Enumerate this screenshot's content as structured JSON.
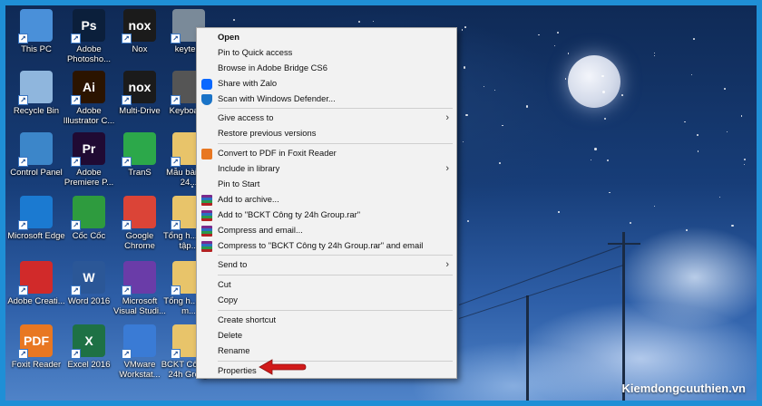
{
  "desktop": {
    "icons": [
      {
        "label": "This PC",
        "abbr": "",
        "bg": "#4a90d9"
      },
      {
        "label": "Adobe Photosho...",
        "abbr": "Ps",
        "bg": "#0b1f3b"
      },
      {
        "label": "Nox",
        "abbr": "nox",
        "bg": "#1b1b1b"
      },
      {
        "label": "keyte...",
        "abbr": "",
        "bg": "#7a8a99"
      },
      {
        "label": "Recycle Bin",
        "abbr": "",
        "bg": "#8fb6dd"
      },
      {
        "label": "Adobe Illustrator C...",
        "abbr": "Ai",
        "bg": "#2b1400"
      },
      {
        "label": "Multi-Drive",
        "abbr": "nox",
        "bg": "#1b1b1b"
      },
      {
        "label": "Keyboar...",
        "abbr": "",
        "bg": "#555"
      },
      {
        "label": "Control Panel",
        "abbr": "",
        "bg": "#3c86c9"
      },
      {
        "label": "Adobe Premiere P...",
        "abbr": "Pr",
        "bg": "#200a33"
      },
      {
        "label": "TranS",
        "abbr": "",
        "bg": "#2ca84a"
      },
      {
        "label": "Mẫu bài tập 24...",
        "abbr": "",
        "bg": "#e8c46a"
      },
      {
        "label": "Microsoft Edge",
        "abbr": "",
        "bg": "#1b7ad1"
      },
      {
        "label": "Cốc Cốc",
        "abbr": "",
        "bg": "#2e9b3e"
      },
      {
        "label": "Google Chrome",
        "abbr": "",
        "bg": "#db4437"
      },
      {
        "label": "Tổng h... đầu tập...",
        "abbr": "",
        "bg": "#e8c46a"
      },
      {
        "label": "Adobe Creati...",
        "abbr": "",
        "bg": "#d12a2a"
      },
      {
        "label": "Word 2016",
        "abbr": "W",
        "bg": "#2b5797"
      },
      {
        "label": "Microsoft Visual Studi...",
        "abbr": "",
        "bg": "#6a3ca8"
      },
      {
        "label": "Tổng h... cáo m...",
        "abbr": "",
        "bg": "#e8c46a"
      },
      {
        "label": "Foxit Reader",
        "abbr": "PDF",
        "bg": "#e87722"
      },
      {
        "label": "Excel 2016",
        "abbr": "X",
        "bg": "#1e7145"
      },
      {
        "label": "VMware Workstat...",
        "abbr": "",
        "bg": "#3a7bd5"
      },
      {
        "label": "BCKT Công ty 24h Group",
        "abbr": "",
        "bg": "#e8c46a"
      }
    ]
  },
  "context_menu": {
    "items": [
      {
        "type": "item",
        "label": "Open",
        "bold": true,
        "icon": ""
      },
      {
        "type": "item",
        "label": "Pin to Quick access",
        "icon": ""
      },
      {
        "type": "item",
        "label": "Browse in Adobe Bridge CS6",
        "icon": ""
      },
      {
        "type": "item",
        "label": "Share with Zalo",
        "icon": "zalo-icon"
      },
      {
        "type": "item",
        "label": "Scan with Windows Defender...",
        "icon": "defender-icon"
      },
      {
        "type": "sep"
      },
      {
        "type": "item",
        "label": "Give access to",
        "submenu": true,
        "icon": ""
      },
      {
        "type": "item",
        "label": "Restore previous versions",
        "icon": ""
      },
      {
        "type": "sep"
      },
      {
        "type": "item",
        "label": "Convert to PDF in Foxit Reader",
        "icon": "foxit-icon"
      },
      {
        "type": "item",
        "label": "Include in library",
        "submenu": true,
        "icon": ""
      },
      {
        "type": "item",
        "label": "Pin to Start",
        "icon": ""
      },
      {
        "type": "item",
        "label": "Add to archive...",
        "icon": "winrar-icon"
      },
      {
        "type": "item",
        "label": "Add to \"BCKT Công ty 24h Group.rar\"",
        "icon": "winrar-icon"
      },
      {
        "type": "item",
        "label": "Compress and email...",
        "icon": "winrar-icon"
      },
      {
        "type": "item",
        "label": "Compress to \"BCKT Công ty 24h Group.rar\" and email",
        "icon": "winrar-icon"
      },
      {
        "type": "sep"
      },
      {
        "type": "item",
        "label": "Send to",
        "submenu": true,
        "icon": ""
      },
      {
        "type": "sep"
      },
      {
        "type": "item",
        "label": "Cut",
        "icon": ""
      },
      {
        "type": "item",
        "label": "Copy",
        "icon": ""
      },
      {
        "type": "sep"
      },
      {
        "type": "item",
        "label": "Create shortcut",
        "icon": ""
      },
      {
        "type": "item",
        "label": "Delete",
        "icon": ""
      },
      {
        "type": "item",
        "label": "Rename",
        "icon": ""
      },
      {
        "type": "sep"
      },
      {
        "type": "item",
        "label": "Properties",
        "icon": ""
      }
    ],
    "submenu_glyph": "›",
    "highlight_arrow_color": "#d11a1a"
  },
  "watermark": "Kiemdongcuuthien.vn",
  "colors": {
    "frame": "#1f8fd6",
    "menu_bg": "#f2f2f2"
  }
}
